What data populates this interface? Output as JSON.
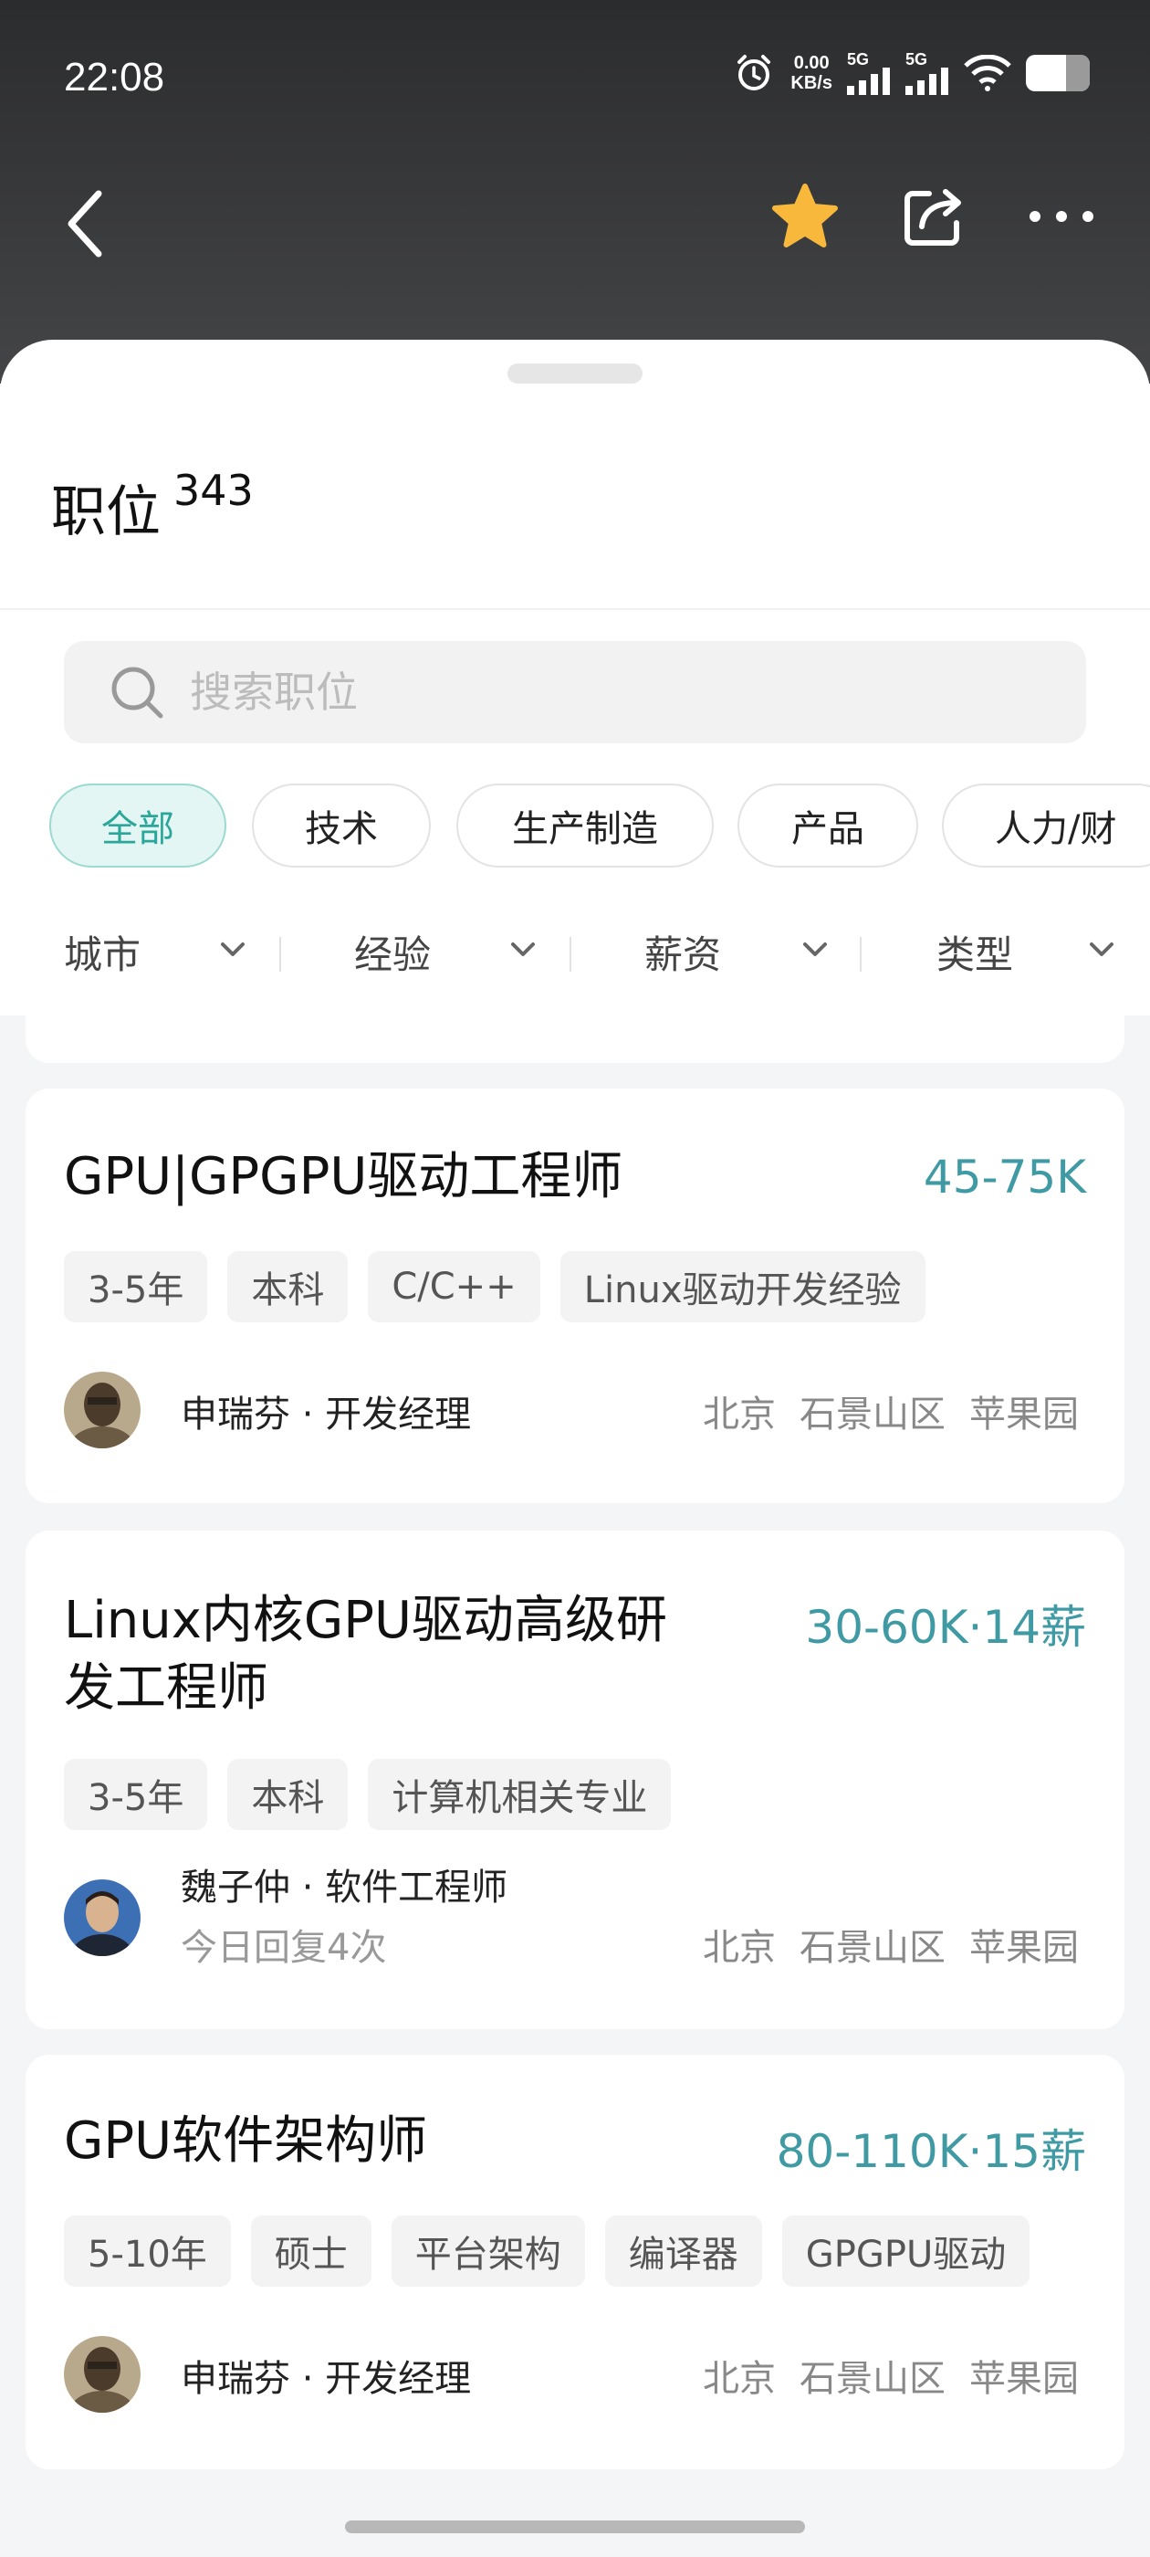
{
  "status_bar": {
    "time": "22:08",
    "net_speed_value": "0.00",
    "net_speed_unit": "KB/s",
    "sim1": "5G",
    "sim2": "5G"
  },
  "nav": {
    "back_icon": "chevron-left-icon",
    "favorite_icon": "star-icon",
    "favorite_color": "#f7b83c",
    "share_icon": "share-icon",
    "more_icon": "more-icon"
  },
  "header": {
    "title": "职位",
    "count": "343"
  },
  "search": {
    "placeholder": "搜索职位"
  },
  "categories": [
    {
      "label": "全部",
      "active": true
    },
    {
      "label": "技术",
      "active": false
    },
    {
      "label": "生产制造",
      "active": false
    },
    {
      "label": "产品",
      "active": false
    },
    {
      "label": "人力/财",
      "active": false
    }
  ],
  "filters": [
    "城市",
    "经验",
    "薪资",
    "类型"
  ],
  "accent_color": "#2aa69a",
  "salary_color": "#3f9aa3",
  "jobs": [
    {
      "title": "GPU|GPGPU驱动工程师",
      "salary": "45-75K",
      "tags": [
        "3-5年",
        "本科",
        "C/C++",
        "Linux驱动开发经验"
      ],
      "recruiter": "申瑞芬 · 开发经理",
      "reply": "",
      "location": [
        "北京",
        "石景山区",
        "苹果园"
      ]
    },
    {
      "title_line1": "Linux内核GPU驱动高级研",
      "title_line2": "发工程师",
      "salary": "30-60K·14薪",
      "tags": [
        "3-5年",
        "本科",
        "计算机相关专业"
      ],
      "recruiter": "魏子仲 · 软件工程师",
      "reply": "今日回复4次",
      "location": [
        "北京",
        "石景山区",
        "苹果园"
      ]
    },
    {
      "title": "GPU软件架构师",
      "salary": "80-110K·15薪",
      "tags": [
        "5-10年",
        "硕士",
        "平台架构",
        "编译器",
        "GPGPU驱动"
      ],
      "recruiter": "申瑞芬 · 开发经理",
      "reply": "",
      "location": [
        "北京",
        "石景山区",
        "苹果园"
      ]
    }
  ]
}
